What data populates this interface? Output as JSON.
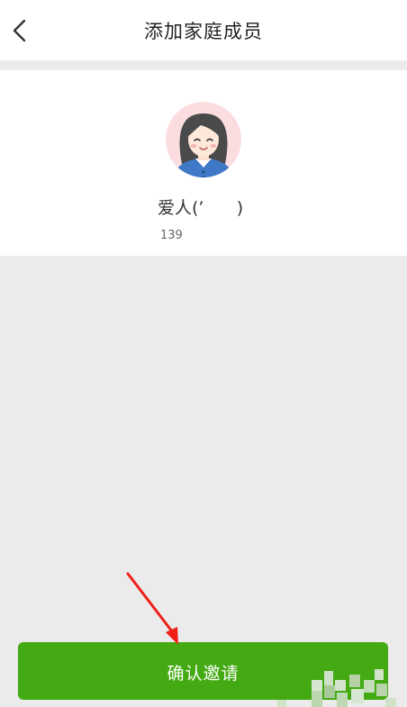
{
  "header": {
    "back_icon": "chevron-left-icon",
    "title": "添加家庭成员"
  },
  "member": {
    "avatar_icon": "female-avatar-icon",
    "name": "爱人(’      )",
    "phone": "139"
  },
  "footer": {
    "confirm_label": "确认邀请"
  },
  "annotation": {
    "arrow_icon": "red-arrow-icon"
  },
  "colors": {
    "accent": "#44aa13",
    "background": "#ebebeb",
    "avatar_bg": "#fbdde0",
    "annotation_arrow": "#f02018"
  }
}
